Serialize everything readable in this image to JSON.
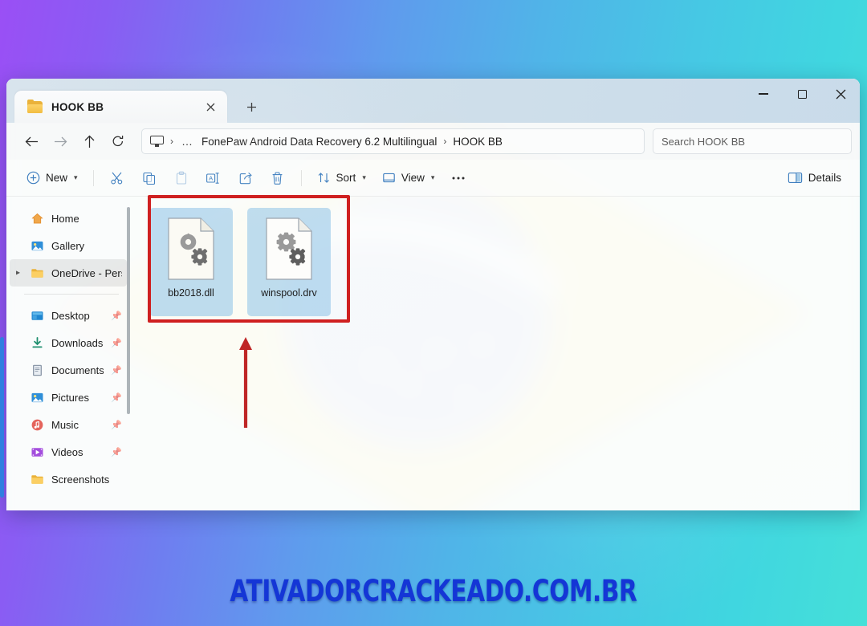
{
  "window": {
    "tab": {
      "title": "HOOK BB",
      "folder_icon": "folder-icon",
      "close_icon": "close-icon"
    },
    "new_tab_icon": "plus-icon",
    "controls": {
      "minimize": "minimize-icon",
      "maximize": "maximize-icon",
      "close": "close-icon"
    }
  },
  "navbar": {
    "back_icon": "arrow-left-icon",
    "forward_icon": "arrow-right-icon",
    "up_icon": "arrow-up-icon",
    "refresh_icon": "refresh-icon",
    "breadcrumb": {
      "root_icon": "this-pc-monitor-icon",
      "separator": "›",
      "overflow": "…",
      "path": "FonePaw Android Data Recovery 6.2 Multilingual",
      "separator2": "›",
      "current": "HOOK BB"
    },
    "search": {
      "placeholder": "Search HOOK BB",
      "value": ""
    }
  },
  "commandbar": {
    "new_label": "New",
    "new_icon": "plus-circle-icon",
    "cut_icon": "scissors-icon",
    "copy_icon": "copy-icon",
    "paste_icon": "paste-icon",
    "rename_icon": "rename-icon",
    "share_icon": "share-icon",
    "delete_icon": "trash-icon",
    "sort_label": "Sort",
    "sort_icon": "sort-arrows-icon",
    "view_label": "View",
    "view_icon": "view-monitor-icon",
    "more_icon": "ellipsis-icon",
    "details_label": "Details",
    "details_icon": "details-pane-icon",
    "chevron": "⌄"
  },
  "sidebar": {
    "items": [
      {
        "label": "Home",
        "icon": "home-icon",
        "pinned": false,
        "expander": false,
        "selected": false
      },
      {
        "label": "Gallery",
        "icon": "gallery-icon",
        "pinned": false,
        "expander": false,
        "selected": false
      },
      {
        "label": "OneDrive - Pers",
        "icon": "onedrive-folder-icon",
        "pinned": false,
        "expander": true,
        "selected": true
      }
    ],
    "items2": [
      {
        "label": "Desktop",
        "icon": "desktop-icon",
        "pinned": true
      },
      {
        "label": "Downloads",
        "icon": "downloads-icon",
        "pinned": true
      },
      {
        "label": "Documents",
        "icon": "documents-icon",
        "pinned": true
      },
      {
        "label": "Pictures",
        "icon": "pictures-icon",
        "pinned": true
      },
      {
        "label": "Music",
        "icon": "music-icon",
        "pinned": true
      },
      {
        "label": "Videos",
        "icon": "videos-icon",
        "pinned": true
      },
      {
        "label": "Screenshots",
        "icon": "folder-icon",
        "pinned": false
      }
    ],
    "pin_glyph": "📌"
  },
  "files": [
    {
      "name": "bb2018.dll",
      "icon": "dll-gears-icon",
      "selected": true
    },
    {
      "name": "winspool.drv",
      "icon": "dll-gears-icon",
      "selected": true
    }
  ],
  "annotations": {
    "highlight_rect_color": "#cf2020",
    "arrow_color": "#bf2626"
  },
  "watermark": {
    "text": "ATIVADORCRACKEADO.COM.BR",
    "color": "#1436d6"
  },
  "background": {
    "gradient_from": "#9a4ff5",
    "gradient_to": "#45e0d8"
  }
}
